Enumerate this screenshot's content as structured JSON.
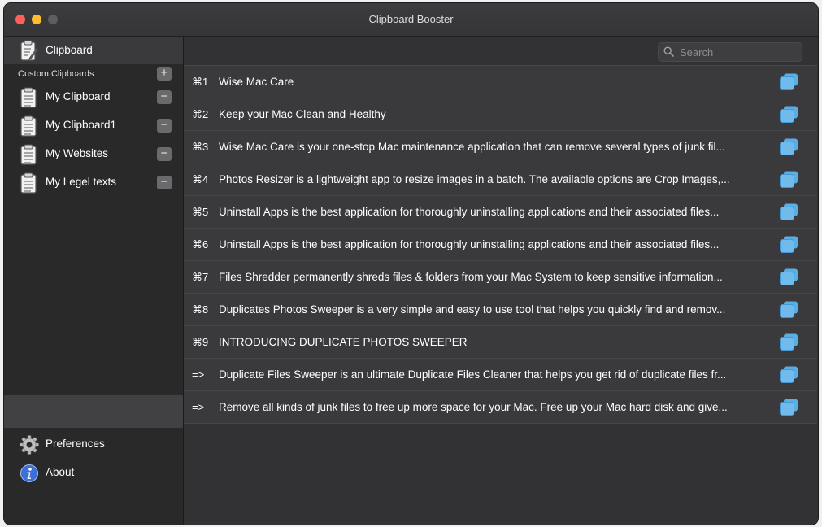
{
  "window": {
    "title": "Clipboard Booster"
  },
  "sidebar": {
    "main_item": {
      "label": "Clipboard",
      "icon": "clipboard-edit-icon"
    },
    "section_title": "Custom Clipboards",
    "add_symbol": "+",
    "remove_symbol": "−",
    "items": [
      {
        "label": "My Clipboard",
        "icon": "clipboard-icon"
      },
      {
        "label": "My Clipboard1",
        "icon": "clipboard-icon"
      },
      {
        "label": "My Websites",
        "icon": "clipboard-icon"
      },
      {
        "label": "My Legel texts",
        "icon": "clipboard-icon"
      }
    ],
    "footer": [
      {
        "label": "Preferences",
        "icon": "gear-icon"
      },
      {
        "label": "About",
        "icon": "info-icon"
      }
    ]
  },
  "search": {
    "placeholder": "Search",
    "value": ""
  },
  "clips": [
    {
      "shortcut": "⌘1",
      "text": "Wise Mac Care"
    },
    {
      "shortcut": "⌘2",
      "text": "Keep your Mac Clean and Healthy"
    },
    {
      "shortcut": "⌘3",
      "text": "Wise Mac Care is your one-stop Mac maintenance application that can remove several types of junk fil..."
    },
    {
      "shortcut": "⌘4",
      "text": "Photos Resizer is a lightweight app to resize images in a batch. The available options are Crop Images,..."
    },
    {
      "shortcut": "⌘5",
      "text": "Uninstall Apps is the best application for thoroughly uninstalling applications and their associated files..."
    },
    {
      "shortcut": "⌘6",
      "text": "Uninstall Apps is the best application for thoroughly uninstalling applications and their associated files..."
    },
    {
      "shortcut": "⌘7",
      "text": "Files Shredder permanently shreds files & folders from your Mac System to keep sensitive information..."
    },
    {
      "shortcut": "⌘8",
      "text": "Duplicates Photos Sweeper is a very simple and easy to use tool that helps you quickly find and remov..."
    },
    {
      "shortcut": "⌘9",
      "text": "INTRODUCING DUPLICATE PHOTOS SWEEPER"
    },
    {
      "shortcut": "=>",
      "text": "Duplicate Files Sweeper is an ultimate Duplicate Files Cleaner that helps you get rid of duplicate files fr..."
    },
    {
      "shortcut": "=>",
      "text": "Remove all kinds of junk files to free up more space for your Mac. Free up your Mac hard disk and give..."
    }
  ],
  "colors": {
    "copy_icon": "#5aaee6",
    "about_icon": "#3d6fd6",
    "close": "#fe5f57",
    "minimize": "#febc2e"
  }
}
